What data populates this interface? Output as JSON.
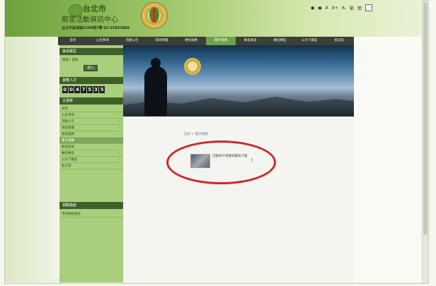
{
  "header": {
    "title_line1": "台北市",
    "title_line2": "鄰里活動資訊中心",
    "title_line3": "台北市區域路2200號7樓 02-23891888",
    "top_tools": [
      "●",
      "●",
      "A",
      "A+",
      "A-",
      "繁",
      "簡"
    ]
  },
  "nav": {
    "items": [
      "首頁",
      "公告事項",
      "活動公告",
      "環境保護",
      "便民服務",
      "電子相簿",
      "鄰里風采",
      "轉出專區",
      "公文下載區",
      "留言版"
    ],
    "active_index": 5
  },
  "sidebar": {
    "login_title": "會員專區",
    "login_hint": "帳號 / 密碼",
    "login_button": "登入",
    "visitors_title": "瀏覽人次",
    "counter_digits": [
      "0",
      "0",
      "4",
      "7",
      "5",
      "3",
      "5"
    ],
    "menu_title": "主選單",
    "menu_items": [
      "首頁",
      "公告事項",
      "活動公告",
      "環境保護",
      "便民服務",
      "電子相簿",
      "鄰里風采",
      "轉出專區",
      "公文下載區",
      "留言版"
    ],
    "menu_active_index": 5,
    "links_title": "相關連結",
    "links_items": [
      "市府網站連結"
    ]
  },
  "content": {
    "breadcrumb": "首頁 > 電子相簿",
    "result": {
      "title": "活動照片相簿瀏覽與下載",
      "mark": "!"
    }
  }
}
